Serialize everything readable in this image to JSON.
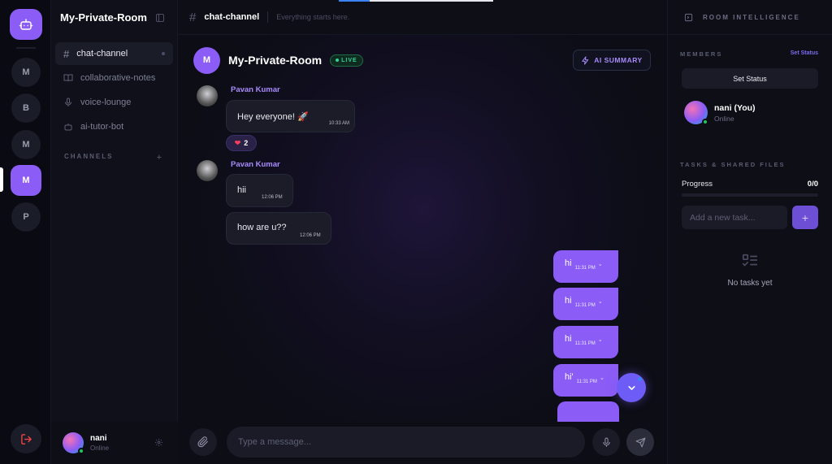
{
  "server_rail": {
    "servers": [
      {
        "initial": "M"
      },
      {
        "initial": "B"
      },
      {
        "initial": "M"
      },
      {
        "initial": "M",
        "active": true
      },
      {
        "initial": "P"
      }
    ]
  },
  "sidebar": {
    "room_name": "My-Private-Room",
    "channels": [
      {
        "name": "chat-channel",
        "icon": "hash-icon",
        "active": true
      },
      {
        "name": "collaborative-notes",
        "icon": "book-icon"
      },
      {
        "name": "voice-lounge",
        "icon": "mic-icon"
      },
      {
        "name": "ai-tutor-bot",
        "icon": "bot-icon"
      }
    ],
    "section_label": "CHANNELS",
    "user": {
      "name": "nani",
      "status": "Online"
    }
  },
  "topbar": {
    "channel": "chat-channel",
    "description": "Everything starts here."
  },
  "room_header": {
    "avatar_initial": "M",
    "title": "My-Private-Room",
    "live_label": "LIVE",
    "ai_summary_label": "AI SUMMARY"
  },
  "messages": {
    "group1": {
      "sender": "Pavan Kumar",
      "items": [
        {
          "text": "Hey everyone! 🚀",
          "time": "10:33 AM"
        }
      ],
      "reaction": {
        "emoji": "❤",
        "count": "2"
      }
    },
    "group2": {
      "sender": "Pavan Kumar",
      "items": [
        {
          "text": "hii",
          "time": "12:06 PM"
        },
        {
          "text": "how are u??",
          "time": "12:06 PM"
        }
      ]
    },
    "mine": [
      {
        "text": "hi",
        "time": "11:31 PM"
      },
      {
        "text": "hi",
        "time": "11:31 PM"
      },
      {
        "text": "hi",
        "time": "11:31 PM"
      },
      {
        "text": "hi'",
        "time": "11:31 PM"
      }
    ]
  },
  "composer": {
    "placeholder": "Type a message..."
  },
  "right_panel": {
    "title": "ROOM INTELLIGENCE",
    "members_label": "MEMBERS",
    "set_status_link": "Set Status",
    "set_status_button": "Set Status",
    "member": {
      "name": "nani (You)",
      "status": "Online"
    },
    "tasks_label": "TASKS & SHARED FILES",
    "progress_label": "Progress",
    "progress_value": "0/0",
    "task_placeholder": "Add a new task...",
    "empty_text": "No tasks yet"
  },
  "colors": {
    "accent": "#8b5cf6",
    "online": "#22c55e",
    "live": "#34d399"
  }
}
